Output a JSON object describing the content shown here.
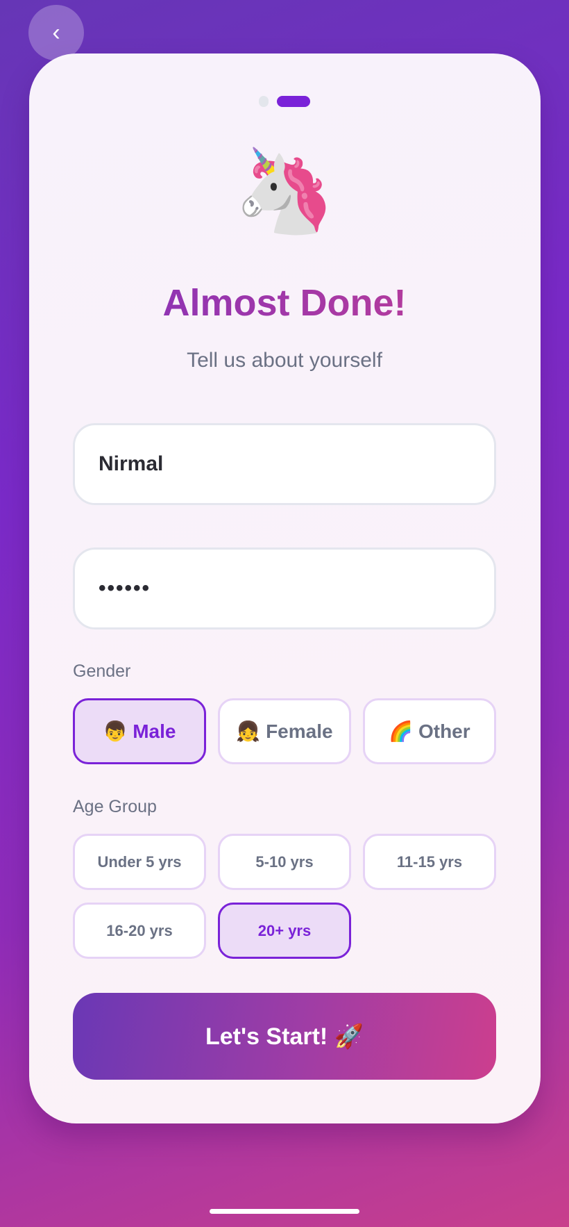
{
  "nav": {
    "back_icon": "chevron-left-icon",
    "back_glyph": "‹"
  },
  "progress": {
    "step": 2,
    "total": 2
  },
  "hero": {
    "emoji": "🦄",
    "title": "Almost Done!",
    "subtitle": "Tell us about yourself"
  },
  "form": {
    "name_value": "Nirmal",
    "password_value": "••••••",
    "gender_label": "Gender",
    "gender_options": [
      {
        "label": "👦 Male",
        "selected": true
      },
      {
        "label": "👧 Female",
        "selected": false
      },
      {
        "label": "🌈 Other",
        "selected": false
      }
    ],
    "age_label": "Age Group",
    "age_options": [
      {
        "label": "Under 5 yrs",
        "selected": false
      },
      {
        "label": "5-10 yrs",
        "selected": false
      },
      {
        "label": "11-15 yrs",
        "selected": false
      },
      {
        "label": "16-20 yrs",
        "selected": false
      },
      {
        "label": "20+ yrs",
        "selected": true
      }
    ],
    "submit_label": "Let's Start! 🚀"
  },
  "colors": {
    "accent": "#7a22d8",
    "pink": "#c84090"
  }
}
